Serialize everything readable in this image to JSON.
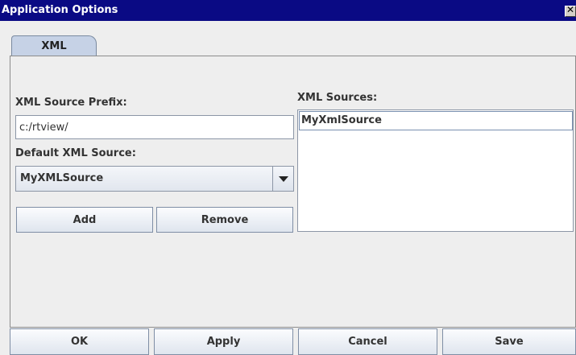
{
  "window": {
    "title": "Application Options",
    "close_glyph": "✕"
  },
  "tabs": [
    {
      "label": "XML"
    }
  ],
  "xml": {
    "prefix_label": "XML Source Prefix:",
    "prefix_value": "c:/rtview/",
    "default_label": "Default XML Source:",
    "default_value": "MyXMLSource",
    "add_label": "Add",
    "remove_label": "Remove",
    "sources_label": "XML Sources:",
    "sources": [
      "MyXmlSource"
    ]
  },
  "footer": {
    "ok_label": "OK",
    "apply_label": "Apply",
    "cancel_label": "Cancel",
    "save_label": "Save"
  },
  "colors": {
    "titlebar": "#0a0a84",
    "tab_background": "#c6d2e6",
    "window_background": "#eeeeee"
  },
  "icons": {
    "close": "close-icon",
    "dropdown": "chevron-down-icon"
  }
}
